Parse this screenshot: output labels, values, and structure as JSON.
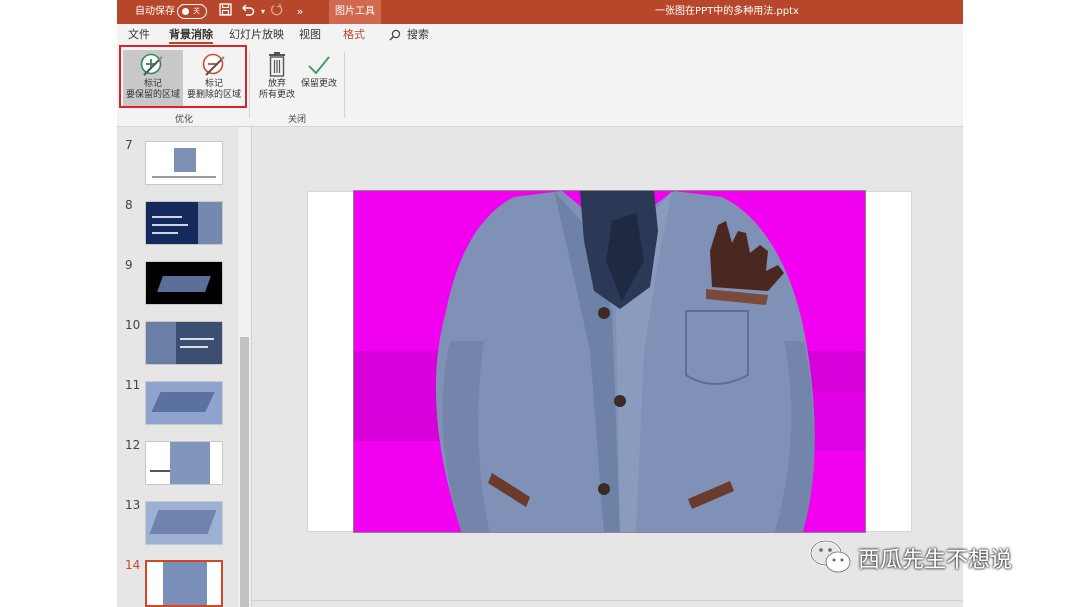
{
  "titlebar": {
    "autosave_label": "自动保存",
    "autosave_state": "关",
    "overflow": "»",
    "tools_tab": "图片工具",
    "document_title": "一张图在PPT中的多种用法.pptx"
  },
  "tabs": [
    {
      "label": "文件"
    },
    {
      "label": "背景消除"
    },
    {
      "label": "幻灯片放映"
    },
    {
      "label": "视图"
    },
    {
      "label": "格式"
    }
  ],
  "search": {
    "label": "搜索"
  },
  "ribbon": {
    "keep": {
      "line1": "标记",
      "line2": "要保留的区域"
    },
    "remove": {
      "line1": "标记",
      "line2": "要删除的区域"
    },
    "discard": {
      "line1": "放弃",
      "line2": "所有更改"
    },
    "save": {
      "label": "保留更改"
    },
    "group_optimize": "优化",
    "group_close": "关闭"
  },
  "slides": [
    {
      "num": "7"
    },
    {
      "num": "8"
    },
    {
      "num": "9"
    },
    {
      "num": "10"
    },
    {
      "num": "11"
    },
    {
      "num": "12"
    },
    {
      "num": "13"
    },
    {
      "num": "14"
    }
  ],
  "colors": {
    "brand": "#b7472a",
    "background_removal_magenta": "#f200f0",
    "highlight": "#d9252a"
  },
  "watermark": {
    "text": "西瓜先生不想说"
  }
}
